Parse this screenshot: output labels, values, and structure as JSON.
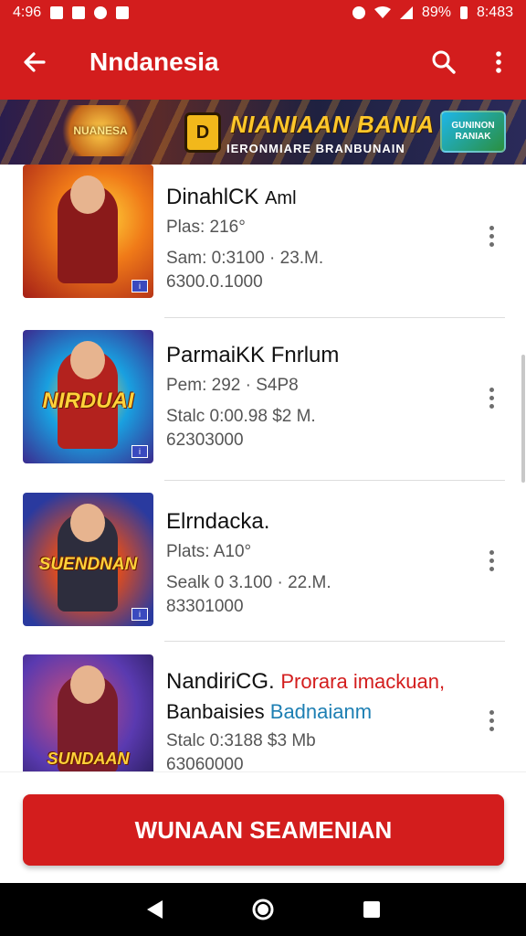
{
  "status_bar": {
    "time_left": "4:96",
    "battery": "89%",
    "time_right": "8:483"
  },
  "app_bar": {
    "title": "Nndanesia",
    "back_icon": "arrow-left-icon",
    "search_icon": "search-icon",
    "more_icon": "more-vertical-icon"
  },
  "banner": {
    "logo_text": "NUANESA",
    "badge_text": "D",
    "title": "NIANIAAN BANIA",
    "subtitle": "IERONMIARE BRANBUNAIN",
    "cta": "GUNINON RANIAK"
  },
  "items": [
    {
      "title": "DinahlCK",
      "title_suffix": "Aml",
      "line1": "Plas: 216°",
      "line2": "Sam: 0:3100 · 23.M.",
      "line3": "6300.0.1000",
      "thumb_text": "",
      "colors": {
        "bg1": "#f4a51c",
        "bg2": "#b3261e",
        "figure": "#8a1a1a"
      }
    },
    {
      "title": "ParmaiKK Fnrlum",
      "line1": "Pem: 292 · S4P8",
      "line2": "Stalc 0:00.98  $2 M.",
      "line3": "62303000",
      "thumb_text": "NIRDUAI",
      "colors": {
        "bg1": "#19a0e0",
        "bg2": "#3b2a8f",
        "figure": "#b3221e"
      }
    },
    {
      "title": "Elrndacka.",
      "line1": "Plats: A10°",
      "line2": "Sealk 0 3.100 · 22.M.",
      "line3": "83301000",
      "thumb_text": "SUENDNAN",
      "colors": {
        "bg1": "#2a3a9f",
        "bg2": "#e34d1b",
        "figure": "#2d2d3d"
      }
    },
    {
      "title": "NandiriCG.",
      "title_red": "Prorara imackuan,",
      "line1": "Banbaisies",
      "line1_blue": "Badnaianm",
      "line2": "Stalc 0:3188  $3 Mb",
      "line3": "63060000",
      "thumb_text": "SUNDAAN",
      "colors": {
        "bg1": "#5a3ab0",
        "bg2": "#d24e78",
        "figure": "#7a1d2a"
      }
    }
  ],
  "primary_button": {
    "label": "WUNAAN SEAMENIAN"
  },
  "nav": {
    "back_icon": "triangle-back-icon",
    "home_icon": "circle-home-icon",
    "recents_icon": "square-recents-icon"
  },
  "theme": {
    "accent": "#d31d1d",
    "text_secondary": "#555555"
  }
}
